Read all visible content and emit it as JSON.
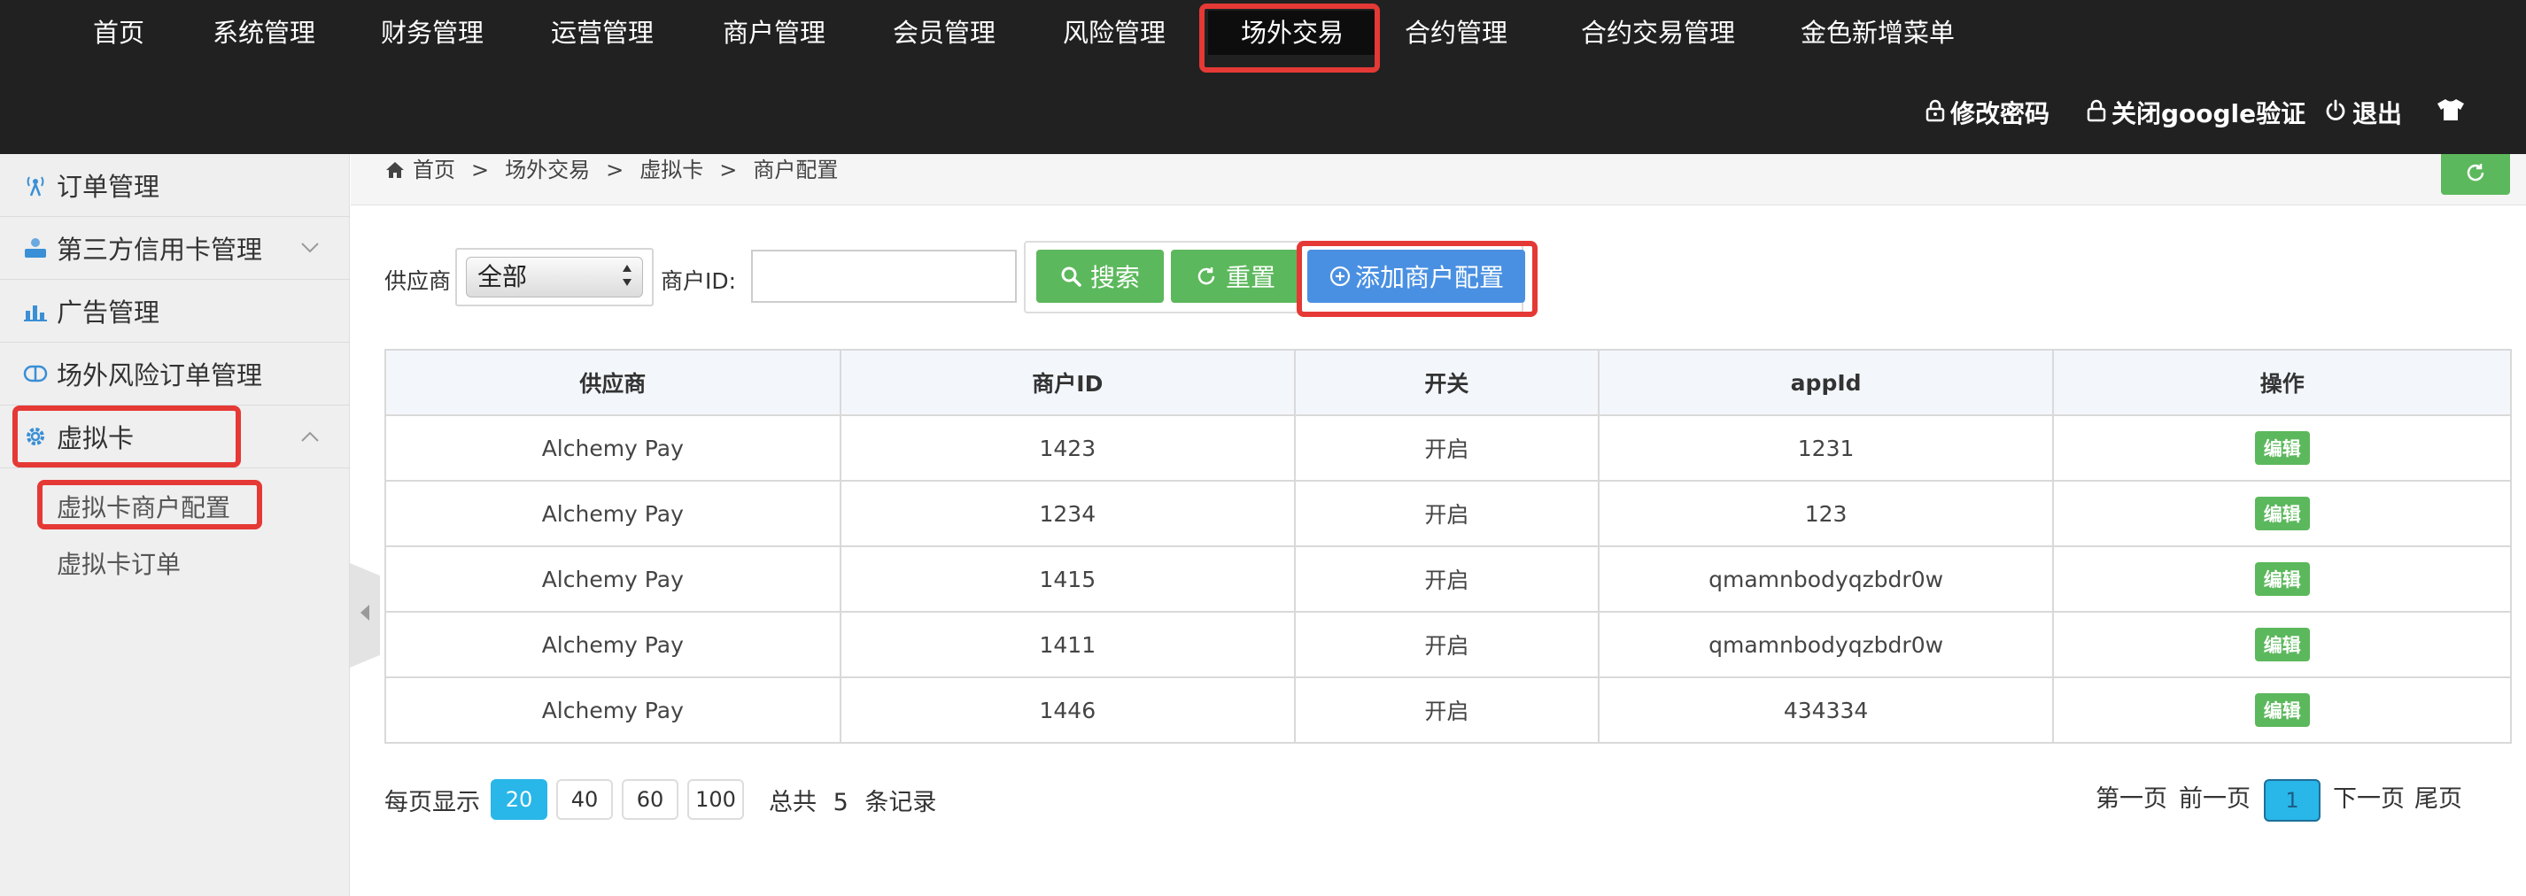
{
  "top_menu": [
    {
      "label": "首页"
    },
    {
      "label": "系统管理"
    },
    {
      "label": "财务管理"
    },
    {
      "label": "运营管理"
    },
    {
      "label": "商户管理"
    },
    {
      "label": "会员管理"
    },
    {
      "label": "风险管理"
    },
    {
      "label": "场外交易",
      "active": true
    },
    {
      "label": "合约管理"
    },
    {
      "label": "合约交易管理"
    },
    {
      "label": "金色新增菜单"
    }
  ],
  "header_actions": {
    "change_password": "修改密码",
    "close_google": "关闭google验证",
    "logout": "退出"
  },
  "sidebar": {
    "items": [
      {
        "label": "订单管理"
      },
      {
        "label": "第三方信用卡管理"
      },
      {
        "label": "广告管理"
      },
      {
        "label": "场外风险订单管理"
      },
      {
        "label": "虚拟卡",
        "expanded": true
      }
    ],
    "sub_items": [
      {
        "label": "虚拟卡商户配置",
        "active": true
      },
      {
        "label": "虚拟卡订单"
      }
    ]
  },
  "breadcrumb": {
    "home": "首页",
    "level1": "场外交易",
    "level2": "虚拟卡",
    "level3": "商户配置",
    "separator": ">"
  },
  "filters": {
    "supplier_label": "供应商",
    "supplier_value": "全部",
    "merchant_label": "商户ID:",
    "merchant_value": "",
    "search_button": "搜索",
    "reset_button": "重置",
    "add_button": "添加商户配置"
  },
  "table": {
    "headers": [
      "供应商",
      "商户ID",
      "开关",
      "appId",
      "操作"
    ],
    "rows": [
      [
        "Alchemy Pay",
        "1423",
        "开启",
        "1231",
        "编辑"
      ],
      [
        "Alchemy Pay",
        "1234",
        "开启",
        "123",
        "编辑"
      ],
      [
        "Alchemy Pay",
        "1415",
        "开启",
        "qmamnbodyqzbdr0w",
        "编辑"
      ],
      [
        "Alchemy Pay",
        "1411",
        "开启",
        "qmamnbodyqzbdr0w",
        "编辑"
      ],
      [
        "Alchemy Pay",
        "1446",
        "开启",
        "434334",
        "编辑"
      ]
    ]
  },
  "pagination": {
    "per_page_label": "每页显示",
    "per_page_options": [
      "20",
      "40",
      "60",
      "100"
    ],
    "per_page_selected": "20",
    "total_prefix": "总共",
    "total_count": "5",
    "total_suffix": "条记录",
    "first": "第一页",
    "prev": "前一页",
    "current": "1",
    "next": "下一页",
    "last": "尾页"
  },
  "colors": {
    "header_bg": "#212121",
    "sidebar_bg": "#efefef",
    "green_button": "#5cb85c",
    "blue_button": "#4a90e2",
    "highlight_red": "#e53935",
    "page_active": "#29b6e8"
  },
  "icons": {
    "change_password": "lock-icon",
    "close_google": "lock-icon",
    "logout": "power-icon",
    "theme": "tshirt-icon",
    "refresh": "refresh-icon",
    "search": "search-icon",
    "reset": "refresh-icon",
    "add": "plus-circle-icon",
    "breadcrumb_home": "home-icon"
  }
}
